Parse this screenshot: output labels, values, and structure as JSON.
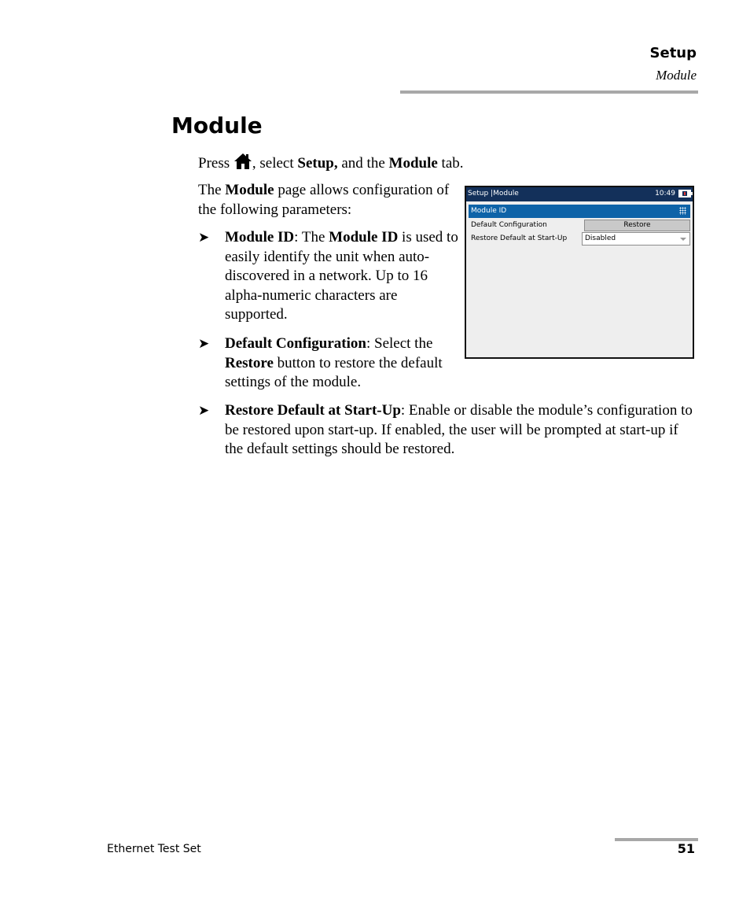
{
  "header": {
    "section": "Setup",
    "subsection": "Module"
  },
  "title": "Module",
  "press_line": {
    "before": "Press ",
    "icon": "home-icon",
    "after1": ", select ",
    "bold1": "Setup,",
    "after2": " and the ",
    "bold2": "Module",
    "after3": " tab."
  },
  "intro": {
    "before": "The ",
    "bold": "Module",
    "after": " page allows configuration of the following parameters:"
  },
  "bullets": [
    {
      "marker": "➤",
      "term": "Module ID",
      "t1": ": The ",
      "bold2": "Module ID",
      "t2": " is used to easily identify the unit when auto-discovered in a network. Up to 16 alpha-numeric characters are supported."
    },
    {
      "marker": "➤",
      "term": "Default Configuration",
      "t1": ": Select the ",
      "bold2": "Restore",
      "t2": " button to restore the default settings of the module."
    },
    {
      "marker": "➤",
      "term": "Restore Default at Start-Up",
      "t1": ": Enable or disable the module’s configuration to be restored upon start-up. If enabled, the user will be prompted at start-up if the default settings should be restored."
    }
  ],
  "device_screen": {
    "title": "Setup |Module",
    "time": "10:49",
    "battery_icon": "battery-charging-icon",
    "rows": {
      "module_id": {
        "label": "Module ID",
        "icon": "keypad-icon"
      },
      "default_config": {
        "label": "Default Configuration",
        "button": "Restore"
      },
      "restore_startup": {
        "label": "Restore Default at Start-Up",
        "value": "Disabled"
      }
    },
    "colors": {
      "titlebar": "#13305a",
      "selected_row": "#0e63a8",
      "panel": "#eeeeee"
    }
  },
  "footer": {
    "doc_title": "Ethernet Test Set",
    "page_number": "51"
  }
}
